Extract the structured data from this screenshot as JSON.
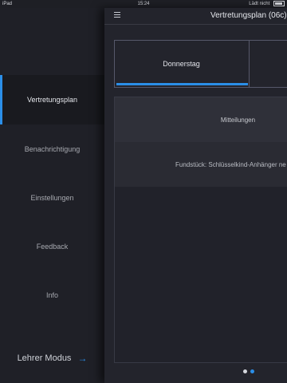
{
  "status_bar": {
    "device": "iPad",
    "time": "15:24",
    "battery_text": "Lädt nicht"
  },
  "drawer": {
    "items": [
      {
        "label": "Vertretungsplan",
        "active": true
      },
      {
        "label": "Benachrichtigung",
        "active": false
      },
      {
        "label": "Einstellungen",
        "active": false
      },
      {
        "label": "Feedback",
        "active": false
      },
      {
        "label": "Info",
        "active": false
      }
    ],
    "lehrer_label": "Lehrer Modus",
    "lehrer_arrow": "→"
  },
  "main": {
    "title": "Vertretungsplan (06c)",
    "tabs": [
      {
        "label": "Donnerstag",
        "selected": true
      },
      {
        "label": "",
        "selected": false
      }
    ],
    "notices": {
      "header": "Mitteilungen",
      "items": [
        "Fundstück: Schlüsselkind-Anhänger ne"
      ]
    },
    "page_dots": {
      "count": 2,
      "active_index": 1
    }
  },
  "colors": {
    "accent": "#2b8fe8",
    "drawer_bg": "#1f2027",
    "main_bg": "#23242c"
  }
}
